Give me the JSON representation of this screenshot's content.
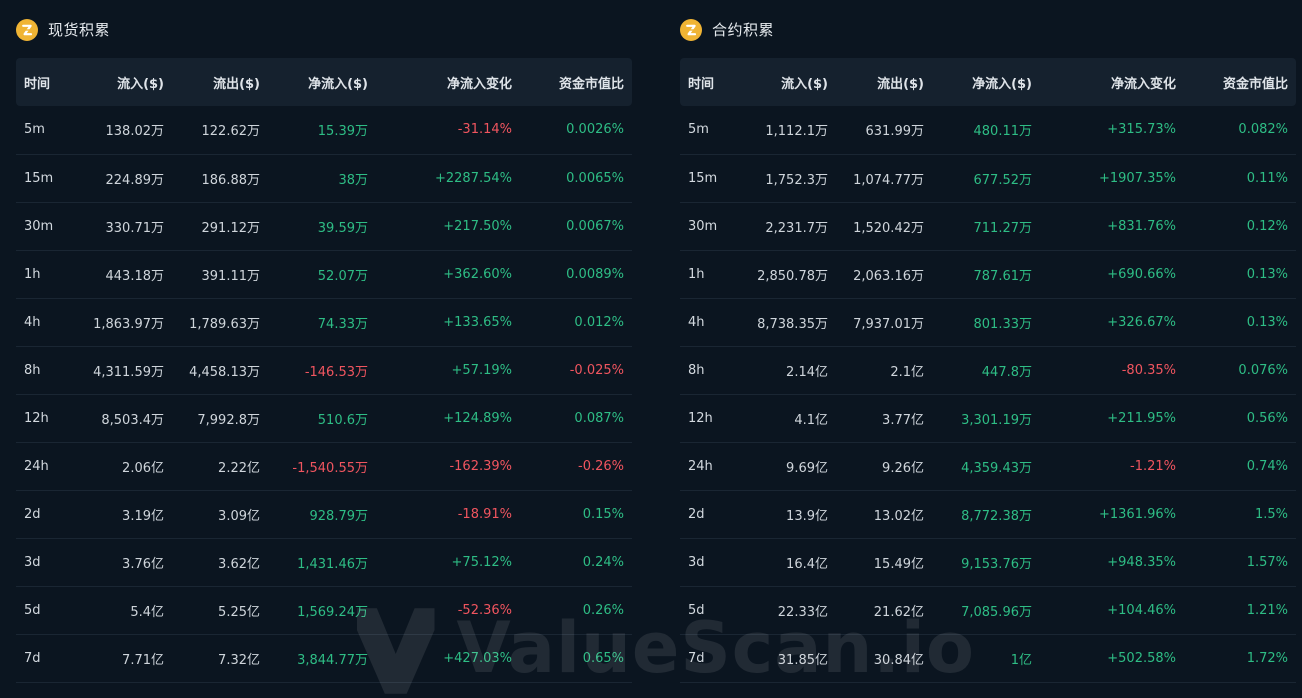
{
  "colors": {
    "background": "#0b1520",
    "header_bg": "#15212e",
    "positive": "#2ebd85",
    "negative": "#f0555f",
    "coin": "#f0b434"
  },
  "watermark": "ValueScan.io",
  "spot": {
    "title": "现货积累",
    "icon": "coin-icon",
    "headers": [
      "时间",
      "流入($)",
      "流出($)",
      "净流入($)",
      "净流入变化",
      "资金市值比"
    ],
    "rows": [
      {
        "time": "5m",
        "inflow": "138.02万",
        "outflow": "122.62万",
        "net": "15.39万",
        "change": "-31.14%",
        "ratio": "0.0026%"
      },
      {
        "time": "15m",
        "inflow": "224.89万",
        "outflow": "186.88万",
        "net": "38万",
        "change": "+2287.54%",
        "ratio": "0.0065%"
      },
      {
        "time": "30m",
        "inflow": "330.71万",
        "outflow": "291.12万",
        "net": "39.59万",
        "change": "+217.50%",
        "ratio": "0.0067%"
      },
      {
        "time": "1h",
        "inflow": "443.18万",
        "outflow": "391.11万",
        "net": "52.07万",
        "change": "+362.60%",
        "ratio": "0.0089%"
      },
      {
        "time": "4h",
        "inflow": "1,863.97万",
        "outflow": "1,789.63万",
        "net": "74.33万",
        "change": "+133.65%",
        "ratio": "0.012%"
      },
      {
        "time": "8h",
        "inflow": "4,311.59万",
        "outflow": "4,458.13万",
        "net": "-146.53万",
        "change": "+57.19%",
        "ratio": "-0.025%"
      },
      {
        "time": "12h",
        "inflow": "8,503.4万",
        "outflow": "7,992.8万",
        "net": "510.6万",
        "change": "+124.89%",
        "ratio": "0.087%"
      },
      {
        "time": "24h",
        "inflow": "2.06亿",
        "outflow": "2.22亿",
        "net": "-1,540.55万",
        "change": "-162.39%",
        "ratio": "-0.26%"
      },
      {
        "time": "2d",
        "inflow": "3.19亿",
        "outflow": "3.09亿",
        "net": "928.79万",
        "change": "-18.91%",
        "ratio": "0.15%"
      },
      {
        "time": "3d",
        "inflow": "3.76亿",
        "outflow": "3.62亿",
        "net": "1,431.46万",
        "change": "+75.12%",
        "ratio": "0.24%"
      },
      {
        "time": "5d",
        "inflow": "5.4亿",
        "outflow": "5.25亿",
        "net": "1,569.24万",
        "change": "-52.36%",
        "ratio": "0.26%"
      },
      {
        "time": "7d",
        "inflow": "7.71亿",
        "outflow": "7.32亿",
        "net": "3,844.77万",
        "change": "+427.03%",
        "ratio": "0.65%"
      }
    ]
  },
  "futures": {
    "title": "合约积累",
    "icon": "coin-icon",
    "headers": [
      "时间",
      "流入($)",
      "流出($)",
      "净流入($)",
      "净流入变化",
      "资金市值比"
    ],
    "rows": [
      {
        "time": "5m",
        "inflow": "1,112.1万",
        "outflow": "631.99万",
        "net": "480.11万",
        "change": "+315.73%",
        "ratio": "0.082%"
      },
      {
        "time": "15m",
        "inflow": "1,752.3万",
        "outflow": "1,074.77万",
        "net": "677.52万",
        "change": "+1907.35%",
        "ratio": "0.11%"
      },
      {
        "time": "30m",
        "inflow": "2,231.7万",
        "outflow": "1,520.42万",
        "net": "711.27万",
        "change": "+831.76%",
        "ratio": "0.12%"
      },
      {
        "time": "1h",
        "inflow": "2,850.78万",
        "outflow": "2,063.16万",
        "net": "787.61万",
        "change": "+690.66%",
        "ratio": "0.13%"
      },
      {
        "time": "4h",
        "inflow": "8,738.35万",
        "outflow": "7,937.01万",
        "net": "801.33万",
        "change": "+326.67%",
        "ratio": "0.13%"
      },
      {
        "time": "8h",
        "inflow": "2.14亿",
        "outflow": "2.1亿",
        "net": "447.8万",
        "change": "-80.35%",
        "ratio": "0.076%"
      },
      {
        "time": "12h",
        "inflow": "4.1亿",
        "outflow": "3.77亿",
        "net": "3,301.19万",
        "change": "+211.95%",
        "ratio": "0.56%"
      },
      {
        "time": "24h",
        "inflow": "9.69亿",
        "outflow": "9.26亿",
        "net": "4,359.43万",
        "change": "-1.21%",
        "ratio": "0.74%"
      },
      {
        "time": "2d",
        "inflow": "13.9亿",
        "outflow": "13.02亿",
        "net": "8,772.38万",
        "change": "+1361.96%",
        "ratio": "1.5%"
      },
      {
        "time": "3d",
        "inflow": "16.4亿",
        "outflow": "15.49亿",
        "net": "9,153.76万",
        "change": "+948.35%",
        "ratio": "1.57%"
      },
      {
        "time": "5d",
        "inflow": "22.33亿",
        "outflow": "21.62亿",
        "net": "7,085.96万",
        "change": "+104.46%",
        "ratio": "1.21%"
      },
      {
        "time": "7d",
        "inflow": "31.85亿",
        "outflow": "30.84亿",
        "net": "1亿",
        "change": "+502.58%",
        "ratio": "1.72%"
      }
    ]
  }
}
